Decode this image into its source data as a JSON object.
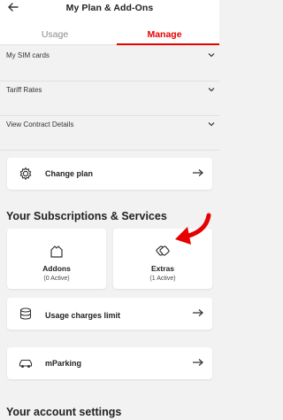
{
  "header": {
    "title": "My Plan & Add-Ons",
    "back_icon": "arrow-left-icon"
  },
  "tabs": [
    {
      "label": "Usage",
      "active": false
    },
    {
      "label": "Manage",
      "active": true
    }
  ],
  "accordion": [
    {
      "label": "My SIM cards"
    },
    {
      "label": "Tariff Rates"
    },
    {
      "label": "View Contract Details"
    }
  ],
  "change_plan": {
    "label": "Change plan",
    "icon": "gear-icon"
  },
  "subscriptions": {
    "title": "Your Subscriptions & Services",
    "tiles": [
      {
        "name": "Addons",
        "status": "(0 Active)",
        "icon": "house-icon"
      },
      {
        "name": "Extras",
        "status": "(1 Active)",
        "icon": "tags-icon"
      }
    ],
    "rows": [
      {
        "label": "Usage charges limit",
        "icon": "coins-icon"
      },
      {
        "label": "mParking",
        "icon": "car-icon"
      }
    ]
  },
  "account": {
    "title": "Your account settings"
  },
  "colors": {
    "accent": "#e60000",
    "background": "#f3f2f2",
    "card": "#ffffff"
  }
}
